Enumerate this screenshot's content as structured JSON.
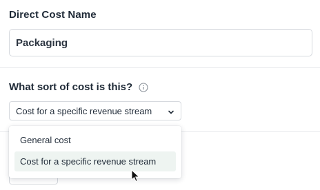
{
  "form": {
    "name_label": "Direct Cost Name",
    "name_value": "Packaging",
    "sort_label": "What sort of cost is this?",
    "sort_selected": "Cost for a specific revenue stream"
  },
  "dropdown": {
    "options": [
      {
        "label": "General cost",
        "selected": false
      },
      {
        "label": "Cost for a specific revenue stream",
        "selected": true
      }
    ]
  },
  "icons": {
    "info": "info-icon",
    "chevron": "chevron-down-icon",
    "cursor": "mouse-pointer-icon"
  },
  "colors": {
    "text": "#1f2a37",
    "border": "#d6d9de",
    "selected_bg": "#eef4f1"
  }
}
